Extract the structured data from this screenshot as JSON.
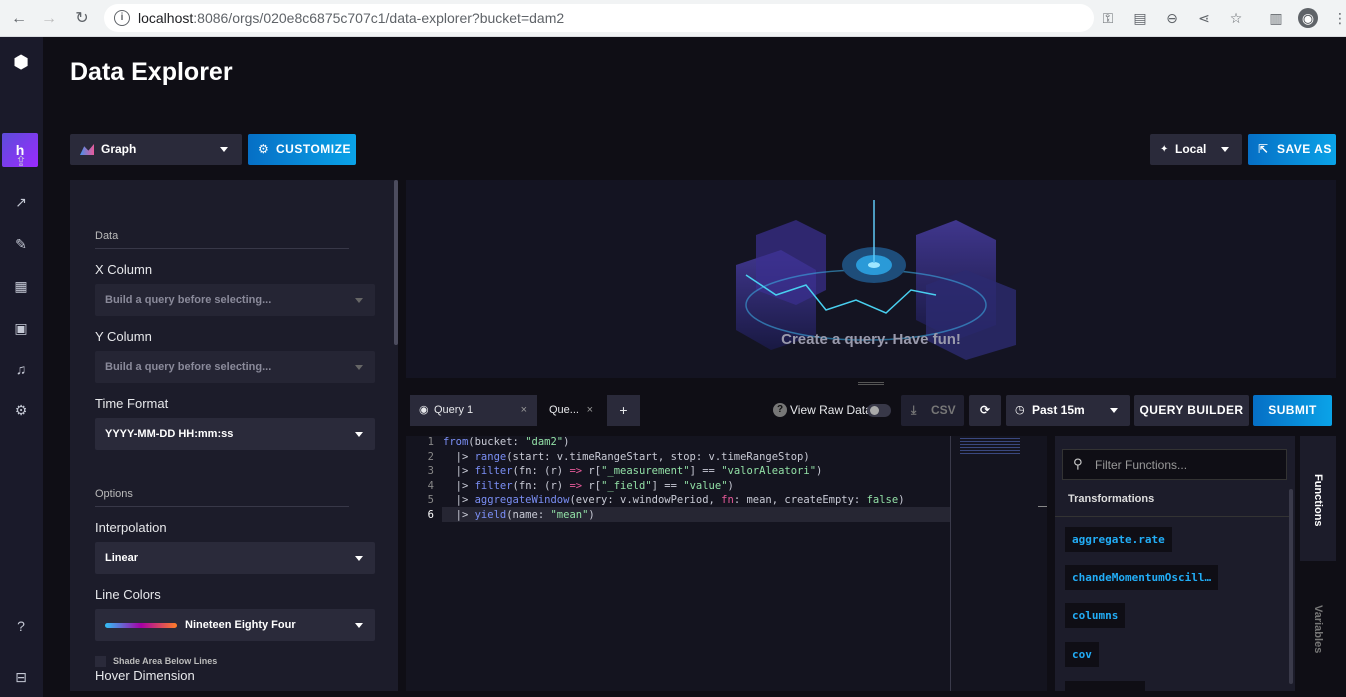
{
  "browser": {
    "url_host": "localhost",
    "url_rest": ":8086/orgs/020e8c6875c707c1/data-explorer?bucket=dam2",
    "info_icon": "i"
  },
  "sidebar": {
    "avatar_initial": "h"
  },
  "header": {
    "title": "Data Explorer"
  },
  "toolbar": {
    "viz_type": "Graph",
    "customize_label": "CUSTOMIZE",
    "timezone": "Local",
    "save_as_label": "SAVE AS"
  },
  "customize_panel": {
    "data_section": "Data",
    "x_column_label": "X Column",
    "x_column_placeholder": "Build a query before selecting...",
    "y_column_label": "Y Column",
    "y_column_placeholder": "Build a query before selecting...",
    "time_format_label": "Time Format",
    "time_format_value": "YYYY-MM-DD HH:mm:ss",
    "options_section": "Options",
    "interpolation_label": "Interpolation",
    "interpolation_value": "Linear",
    "line_colors_label": "Line Colors",
    "line_colors_value": "Nineteen Eighty Four",
    "shade_area_label": "Shade Area Below Lines",
    "hover_dimension_label": "Hover Dimension"
  },
  "visualization": {
    "empty_message": "Create a query. Have fun!"
  },
  "query_bar": {
    "tabs": [
      {
        "label": "Query 1"
      },
      {
        "label": "Que..."
      }
    ],
    "add_tab": "+",
    "view_raw_label": "View Raw Data",
    "view_raw_on": false,
    "csv_label": "CSV",
    "time_range": "Past 15m",
    "query_builder_label": "QUERY BUILDER",
    "submit_label": "SUBMIT"
  },
  "editor": {
    "lines": [
      {
        "n": "1",
        "html_key": "l1"
      },
      {
        "n": "2",
        "html_key": "l2"
      },
      {
        "n": "3",
        "html_key": "l3"
      },
      {
        "n": "4",
        "html_key": "l4"
      },
      {
        "n": "5",
        "html_key": "l5"
      },
      {
        "n": "6",
        "html_key": "l6"
      }
    ],
    "code": {
      "l1_a": "from",
      "l1_b": "(bucket: ",
      "l1_c": "\"dam2\"",
      "l1_d": ")",
      "l2_a": "  |> ",
      "l2_b": "range",
      "l2_c": "(start: v.timeRangeStart, stop: v.timeRangeStop)",
      "l3_a": "  |> ",
      "l3_b": "filter",
      "l3_c": "(fn: (r) ",
      "l3_d": "=>",
      "l3_e": " r[",
      "l3_f": "\"_measurement\"",
      "l3_g": "] == ",
      "l3_h": "\"valorAleatori\"",
      "l3_i": ")",
      "l4_a": "  |> ",
      "l4_b": "filter",
      "l4_c": "(fn: (r) ",
      "l4_d": "=>",
      "l4_e": " r[",
      "l4_f": "\"_field\"",
      "l4_g": "] == ",
      "l4_h": "\"value\"",
      "l4_i": ")",
      "l5_a": "  |> ",
      "l5_b": "aggregateWindow",
      "l5_c": "(every: v.windowPeriod, ",
      "l5_d": "fn",
      "l5_e": ": mean, createEmpty: ",
      "l5_f": "false",
      "l5_g": ")",
      "l6_a": "  |> ",
      "l6_b": "yield",
      "l6_c": "(name: ",
      "l6_d": "\"mean\"",
      "l6_e": ")"
    }
  },
  "functions_panel": {
    "search_placeholder": "Filter Functions...",
    "category": "Transformations",
    "items": [
      "aggregate.rate",
      "chandeMomentumOscill…",
      "columns",
      "cov"
    ],
    "tab_functions": "Functions",
    "tab_variables": "Variables"
  }
}
